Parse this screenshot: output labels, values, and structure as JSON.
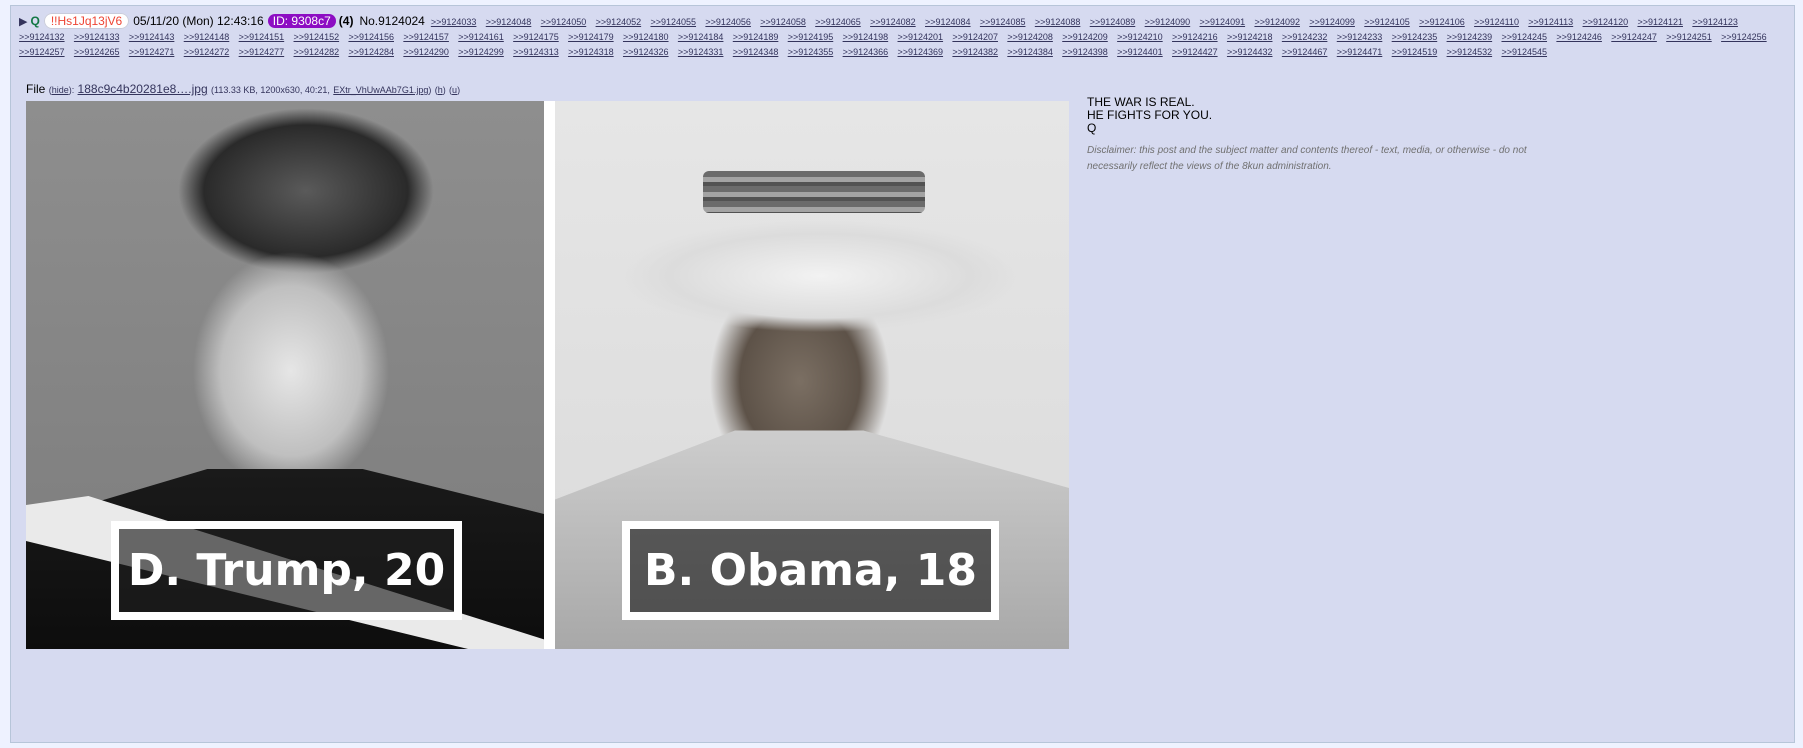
{
  "post": {
    "name": "Q",
    "tripcode": "!!Hs1Jq13jV6",
    "date": "05/11/20 (Mon) 12:43:16",
    "id_label": "ID: 9308c7",
    "post_count": "(4)",
    "post_number": "No.9124024",
    "backlinks": [
      ">>9124033",
      ">>9124048",
      ">>9124050",
      ">>9124052",
      ">>9124055",
      ">>9124056",
      ">>9124058",
      ">>9124065",
      ">>9124082",
      ">>9124084",
      ">>9124085",
      ">>9124088",
      ">>9124089",
      ">>9124090",
      ">>9124091",
      ">>9124092",
      ">>9124099",
      ">>9124105",
      ">>9124106",
      ">>9124110",
      ">>9124113",
      ">>9124120",
      ">>9124121",
      ">>9124123",
      ">>9124132",
      ">>9124133",
      ">>9124143",
      ">>9124148",
      ">>9124151",
      ">>9124152",
      ">>9124156",
      ">>9124157",
      ">>9124161",
      ">>9124175",
      ">>9124179",
      ">>9124180",
      ">>9124184",
      ">>9124189",
      ">>9124195",
      ">>9124198",
      ">>9124201",
      ">>9124207",
      ">>9124208",
      ">>9124209",
      ">>9124210",
      ">>9124216",
      ">>9124218",
      ">>9124232",
      ">>9124233",
      ">>9124235",
      ">>9124239",
      ">>9124245",
      ">>9124246",
      ">>9124247",
      ">>9124251",
      ">>9124256",
      ">>9124257",
      ">>9124265",
      ">>9124271",
      ">>9124272",
      ">>9124277",
      ">>9124282",
      ">>9124284",
      ">>9124290",
      ">>9124299",
      ">>9124313",
      ">>9124318",
      ">>9124326",
      ">>9124331",
      ">>9124348",
      ">>9124355",
      ">>9124366",
      ">>9124369",
      ">>9124382",
      ">>9124384",
      ">>9124398",
      ">>9124401",
      ">>9124427",
      ">>9124432",
      ">>9124467",
      ">>9124471",
      ">>9124519",
      ">>9124532",
      ">>9124545"
    ]
  },
  "file": {
    "label": "File",
    "hide_label": "hide",
    "filename": "188c9c4b20281e8….jpg",
    "meta": "(113.33 KB, 1200x630, 40:21,",
    "original_name": "EXtr_VhUwAAb7G1.jpg",
    "close_paren": ")",
    "h_label": "h",
    "u_label": "u"
  },
  "image": {
    "left_caption": "D. Trump, 20",
    "right_caption": "B. Obama, 18"
  },
  "message": {
    "lines": [
      "THE WAR IS REAL.",
      "HE FIGHTS FOR YOU.",
      "Q"
    ],
    "disclaimer": "Disclaimer: this post and the subject matter and contents thereof - text, media, or otherwise - do not necessarily reflect the views of the 8kun administration."
  },
  "colors": {
    "post_bg": "#d6daf0",
    "page_bg": "#eef2ff",
    "name": "#117743",
    "tripcode": "#ee4433",
    "id_badge": "#8d0dc3",
    "link": "#34345c"
  }
}
